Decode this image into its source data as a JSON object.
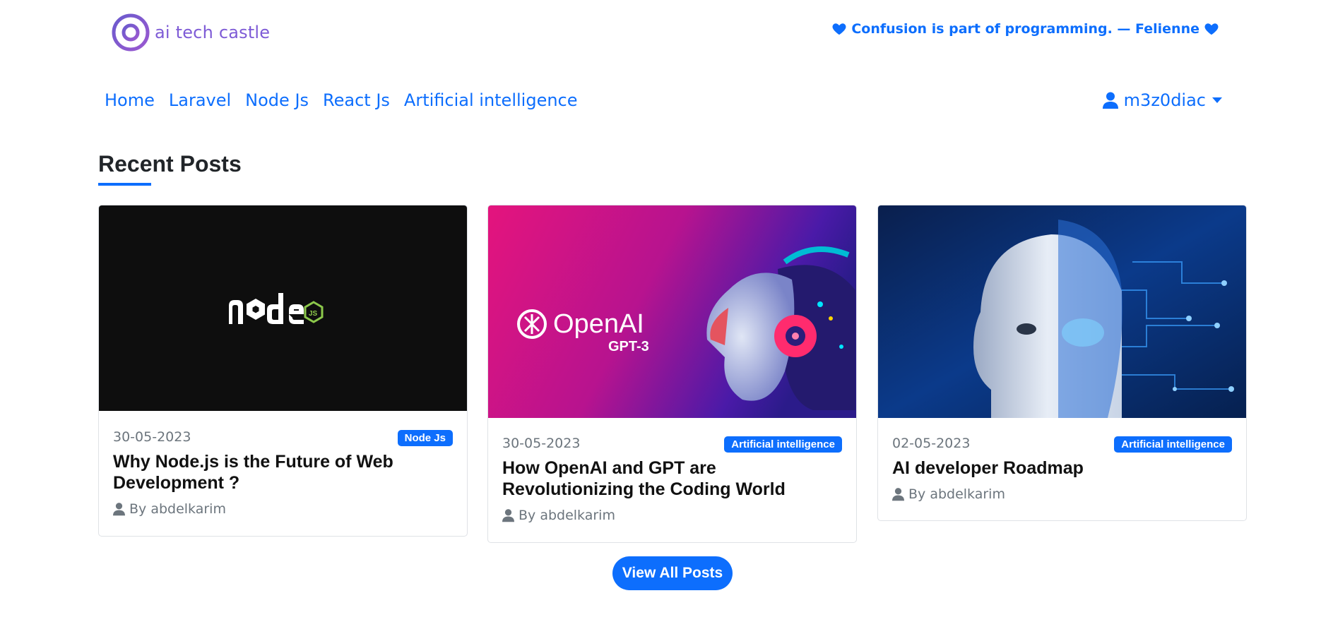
{
  "brand": {
    "name": "ai tech castle",
    "logo_icon": "circle-logo-icon"
  },
  "quote": {
    "text": "Confusion is part of programming. — Felienne",
    "icon": "heart-icon"
  },
  "nav": {
    "items": [
      "Home",
      "Laravel",
      "Node Js",
      "React Js",
      "Artificial intelligence"
    ]
  },
  "user": {
    "name": "m3z0diac",
    "icon": "user-icon",
    "caret_icon": "caret-down-icon"
  },
  "section": {
    "title": "Recent Posts"
  },
  "posts": [
    {
      "date": "30-05-2023",
      "category": "Node Js",
      "title": "Why Node.js is the Future of Web Development ?",
      "author": "By abdelkarim"
    },
    {
      "date": "30-05-2023",
      "category": "Artificial intelligence",
      "title": "How OpenAI and GPT are Revolutionizing the Coding World",
      "author": "By abdelkarim",
      "image_text": "OpenAI",
      "image_subtext": "GPT-3"
    },
    {
      "date": "02-05-2023",
      "category": "Artificial intelligence",
      "title": "AI developer Roadmap",
      "author": "By abdelkarim"
    }
  ],
  "view_all": {
    "label": "View All Posts"
  },
  "colors": {
    "primary": "#0d6efd",
    "brand": "#7e5bd6",
    "muted": "#6c757d"
  }
}
